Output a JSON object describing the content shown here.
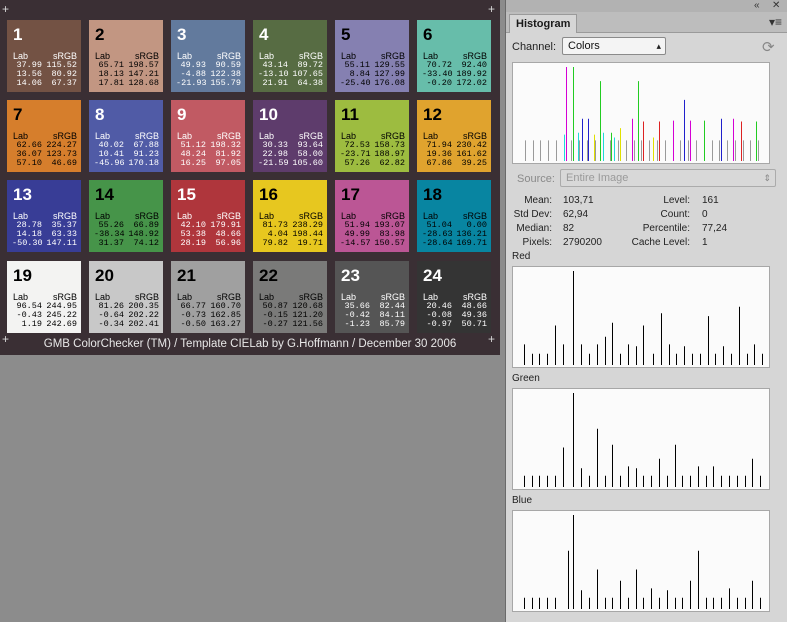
{
  "chart_title_caption": "GMB ColorChecker (TM) / Template CIELab by G.Hoffmann / December 30 2006",
  "patches": [
    {
      "num": "1",
      "lab": "Lab",
      "srgb": "sRGB",
      "l": "37.99\n13.56\n14.06",
      "r": "115.52\n80.92\n67.37",
      "bg": "#735244",
      "fg": "#ffffff"
    },
    {
      "num": "2",
      "lab": "Lab",
      "srgb": "sRGB",
      "l": "65.71\n18.13\n17.81",
      "r": "198.57\n147.21\n128.68",
      "bg": "#c29682",
      "fg": "#000000"
    },
    {
      "num": "3",
      "lab": "Lab",
      "srgb": "sRGB",
      "l": "49.93\n-4.88\n-21.93",
      "r": "90.59\n122.38\n155.79",
      "bg": "#627a9d",
      "fg": "#ffffff"
    },
    {
      "num": "4",
      "lab": "Lab",
      "srgb": "sRGB",
      "l": "43.14\n-13.10\n21.91",
      "r": "89.72\n107.65\n64.38",
      "bg": "#576c43",
      "fg": "#ffffff"
    },
    {
      "num": "5",
      "lab": "Lab",
      "srgb": "sRGB",
      "l": "55.11\n8.84\n-25.40",
      "r": "129.55\n127.99\n176.08",
      "bg": "#8580b1",
      "fg": "#000000"
    },
    {
      "num": "6",
      "lab": "Lab",
      "srgb": "sRGB",
      "l": "70.72\n-33.40\n-0.20",
      "r": "92.40\n189.92\n172.02",
      "bg": "#67bdaa",
      "fg": "#000000"
    },
    {
      "num": "7",
      "lab": "Lab",
      "srgb": "sRGB",
      "l": "62.66\n36.07\n57.10",
      "r": "224.27\n123.73\n46.69",
      "bg": "#d67e2c",
      "fg": "#000000"
    },
    {
      "num": "8",
      "lab": "Lab",
      "srgb": "sRGB",
      "l": "40.02\n10.41\n-45.96",
      "r": "67.88\n91.23\n170.18",
      "bg": "#505ba6",
      "fg": "#ffffff"
    },
    {
      "num": "9",
      "lab": "Lab",
      "srgb": "sRGB",
      "l": "51.12\n48.24\n16.25",
      "r": "198.32\n81.92\n97.05",
      "bg": "#c15a63",
      "fg": "#ffffff"
    },
    {
      "num": "10",
      "lab": "Lab",
      "srgb": "sRGB",
      "l": "30.33\n22.98\n-21.59",
      "r": "93.64\n58.00\n105.60",
      "bg": "#5e3c6c",
      "fg": "#ffffff"
    },
    {
      "num": "11",
      "lab": "Lab",
      "srgb": "sRGB",
      "l": "72.53\n-23.71\n57.26",
      "r": "158.73\n188.97\n62.82",
      "bg": "#9dbc40",
      "fg": "#000000"
    },
    {
      "num": "12",
      "lab": "Lab",
      "srgb": "sRGB",
      "l": "71.94\n19.36\n67.86",
      "r": "230.42\n161.62\n39.25",
      "bg": "#e0a32e",
      "fg": "#000000"
    },
    {
      "num": "13",
      "lab": "Lab",
      "srgb": "sRGB",
      "l": "28.78\n14.18\n-50.30",
      "r": "35.37\n63.33\n147.11",
      "bg": "#383d96",
      "fg": "#ffffff"
    },
    {
      "num": "14",
      "lab": "Lab",
      "srgb": "sRGB",
      "l": "55.26\n-38.34\n31.37",
      "r": "66.89\n148.92\n74.12",
      "bg": "#469449",
      "fg": "#000000"
    },
    {
      "num": "15",
      "lab": "Lab",
      "srgb": "sRGB",
      "l": "42.10\n53.38\n28.19",
      "r": "179.91\n48.66\n56.96",
      "bg": "#af363c",
      "fg": "#ffffff"
    },
    {
      "num": "16",
      "lab": "Lab",
      "srgb": "sRGB",
      "l": "81.73\n4.04\n79.82",
      "r": "238.29\n198.44\n19.71",
      "bg": "#e7c71f",
      "fg": "#000000"
    },
    {
      "num": "17",
      "lab": "Lab",
      "srgb": "sRGB",
      "l": "51.94\n49.99\n-14.57",
      "r": "193.07\n83.98\n150.57",
      "bg": "#bb5695",
      "fg": "#000000"
    },
    {
      "num": "18",
      "lab": "Lab",
      "srgb": "sRGB",
      "l": "51.04\n-28.63\n-28.64",
      "r": "0.00\n136.21\n169.71",
      "bg": "#0885a1",
      "fg": "#000000"
    },
    {
      "num": "19",
      "lab": "Lab",
      "srgb": "sRGB",
      "l": "96.54\n-0.43\n1.19",
      "r": "244.95\n245.22\n242.69",
      "bg": "#f3f3f2",
      "fg": "#000000"
    },
    {
      "num": "20",
      "lab": "Lab",
      "srgb": "sRGB",
      "l": "81.26\n-0.64\n-0.34",
      "r": "200.35\n202.22\n202.41",
      "bg": "#c8c8c8",
      "fg": "#000000"
    },
    {
      "num": "21",
      "lab": "Lab",
      "srgb": "sRGB",
      "l": "66.77\n-0.73\n-0.50",
      "r": "160.70\n162.85\n163.27",
      "bg": "#a0a0a0",
      "fg": "#000000"
    },
    {
      "num": "22",
      "lab": "Lab",
      "srgb": "sRGB",
      "l": "50.87\n-0.15\n-0.27",
      "r": "120.68\n121.20\n121.56",
      "bg": "#7a7a79",
      "fg": "#000000"
    },
    {
      "num": "23",
      "lab": "Lab",
      "srgb": "sRGB",
      "l": "35.66\n-0.42\n-1.23",
      "r": "82.44\n84.11\n85.79",
      "bg": "#555555",
      "fg": "#ffffff"
    },
    {
      "num": "24",
      "lab": "Lab",
      "srgb": "sRGB",
      "l": "20.46\n-0.08\n-0.97",
      "r": "48.66\n49.36\n50.71",
      "bg": "#343434",
      "fg": "#ffffff"
    }
  ],
  "panel": {
    "tab_label": "Histogram",
    "channel_label": "Channel:",
    "channel_value": "Colors",
    "source_label": "Source:",
    "source_value": "Entire Image",
    "stats": {
      "mean_label": "Mean:",
      "mean": "103,71",
      "std_label": "Std Dev:",
      "std": "62,94",
      "median_label": "Median:",
      "median": "82",
      "pixels_label": "Pixels:",
      "pixels": "2790200",
      "level_label": "Level:",
      "level": "161",
      "count_label": "Count:",
      "count": "0",
      "percentile_label": "Percentile:",
      "percentile": "77,24",
      "cache_label": "Cache Level:",
      "cache": "1"
    },
    "red_label": "Red",
    "green_label": "Green",
    "blue_label": "Blue"
  },
  "icons": {
    "collapse": "double-chevron-icon",
    "close": "close-icon",
    "menu": "panel-menu-icon",
    "refresh": "refresh-icon"
  },
  "chart_data": [
    {
      "type": "bar",
      "title": "Colors",
      "xlim": [
        0,
        255
      ],
      "ylim": [
        0,
        1
      ],
      "series": [
        {
          "color": "#9a9a9a",
          "bars": [
            [
              8,
              0.22
            ],
            [
              16,
              0.22
            ],
            [
              24,
              0.22
            ],
            [
              32,
              0.22
            ],
            [
              40,
              0.22
            ],
            [
              48,
              0.22
            ],
            [
              56,
              0.22
            ],
            [
              64,
              0.22
            ],
            [
              72,
              0.22
            ],
            [
              80,
              0.22
            ],
            [
              88,
              0.22
            ],
            [
              96,
              0.22
            ],
            [
              104,
              0.22
            ],
            [
              112,
              0.22
            ],
            [
              120,
              0.22
            ],
            [
              128,
              0.22
            ],
            [
              136,
              0.22
            ],
            [
              144,
              0.22
            ],
            [
              152,
              0.22
            ],
            [
              160,
              0.22
            ],
            [
              168,
              0.22
            ],
            [
              176,
              0.22
            ],
            [
              184,
              0.22
            ],
            [
              192,
              0.22
            ],
            [
              200,
              0.22
            ],
            [
              208,
              0.22
            ],
            [
              216,
              0.22
            ],
            [
              224,
              0.22
            ],
            [
              232,
              0.22
            ],
            [
              240,
              0.22
            ],
            [
              248,
              0.22
            ]
          ]
        },
        {
          "color": "#d400d4",
          "bars": [
            [
              50,
              1.0
            ],
            [
              118,
              0.45
            ],
            [
              160,
              0.43
            ],
            [
              178,
              0.43
            ],
            [
              222,
              0.45
            ]
          ]
        },
        {
          "color": "#22cc22",
          "bars": [
            [
              58,
              1.0
            ],
            [
              85,
              0.85
            ],
            [
              97,
              0.3
            ],
            [
              124,
              0.85
            ],
            [
              192,
              0.43
            ],
            [
              246,
              0.42
            ]
          ]
        },
        {
          "color": "#2020cc",
          "bars": [
            [
              67,
              0.45
            ],
            [
              73,
              0.45
            ],
            [
              172,
              0.65
            ],
            [
              210,
              0.45
            ]
          ]
        },
        {
          "color": "#22d8d8",
          "bars": [
            [
              48,
              0.28
            ],
            [
              63,
              0.3
            ],
            [
              88,
              0.3
            ],
            [
              100,
              0.25
            ]
          ]
        },
        {
          "color": "#e0e000",
          "bars": [
            [
              79,
              0.28
            ],
            [
              106,
              0.35
            ],
            [
              140,
              0.25
            ]
          ]
        },
        {
          "color": "#dd2222",
          "bars": [
            [
              130,
              0.42
            ],
            [
              146,
              0.42
            ],
            [
              230,
              0.42
            ]
          ]
        }
      ]
    },
    {
      "type": "bar",
      "title": "Red",
      "xlim": [
        0,
        255
      ],
      "ylim": [
        0,
        1
      ],
      "series": [
        {
          "name": "Red",
          "color": "#000000",
          "bars": [
            [
              7,
              0.22
            ],
            [
              15,
              0.12
            ],
            [
              23,
              0.12
            ],
            [
              31,
              0.12
            ],
            [
              39,
              0.42
            ],
            [
              47,
              0.22
            ],
            [
              58,
              1.0
            ],
            [
              66,
              0.22
            ],
            [
              74,
              0.12
            ],
            [
              82,
              0.22
            ],
            [
              90,
              0.3
            ],
            [
              98,
              0.45
            ],
            [
              106,
              0.12
            ],
            [
              114,
              0.22
            ],
            [
              122,
              0.2
            ],
            [
              130,
              0.42
            ],
            [
              140,
              0.12
            ],
            [
              148,
              0.55
            ],
            [
              156,
              0.22
            ],
            [
              164,
              0.12
            ],
            [
              172,
              0.2
            ],
            [
              180,
              0.12
            ],
            [
              188,
              0.12
            ],
            [
              196,
              0.52
            ],
            [
              204,
              0.12
            ],
            [
              212,
              0.2
            ],
            [
              220,
              0.12
            ],
            [
              228,
              0.62
            ],
            [
              236,
              0.12
            ],
            [
              244,
              0.22
            ],
            [
              252,
              0.12
            ]
          ]
        }
      ]
    },
    {
      "type": "bar",
      "title": "Green",
      "xlim": [
        0,
        255
      ],
      "ylim": [
        0,
        1
      ],
      "series": [
        {
          "name": "Green",
          "color": "#000000",
          "bars": [
            [
              7,
              0.12
            ],
            [
              15,
              0.12
            ],
            [
              23,
              0.12
            ],
            [
              31,
              0.12
            ],
            [
              39,
              0.12
            ],
            [
              47,
              0.42
            ],
            [
              58,
              1.0
            ],
            [
              66,
              0.2
            ],
            [
              74,
              0.12
            ],
            [
              82,
              0.62
            ],
            [
              90,
              0.12
            ],
            [
              98,
              0.45
            ],
            [
              106,
              0.12
            ],
            [
              114,
              0.22
            ],
            [
              122,
              0.2
            ],
            [
              130,
              0.12
            ],
            [
              138,
              0.12
            ],
            [
              146,
              0.3
            ],
            [
              154,
              0.12
            ],
            [
              162,
              0.45
            ],
            [
              170,
              0.12
            ],
            [
              178,
              0.12
            ],
            [
              186,
              0.22
            ],
            [
              194,
              0.12
            ],
            [
              202,
              0.22
            ],
            [
              210,
              0.12
            ],
            [
              218,
              0.12
            ],
            [
              226,
              0.12
            ],
            [
              234,
              0.12
            ],
            [
              242,
              0.3
            ],
            [
              250,
              0.12
            ]
          ]
        }
      ]
    },
    {
      "type": "bar",
      "title": "Blue",
      "xlim": [
        0,
        255
      ],
      "ylim": [
        0,
        1
      ],
      "series": [
        {
          "name": "Blue",
          "color": "#000000",
          "bars": [
            [
              7,
              0.12
            ],
            [
              15,
              0.12
            ],
            [
              23,
              0.12
            ],
            [
              31,
              0.12
            ],
            [
              39,
              0.12
            ],
            [
              52,
              0.62
            ],
            [
              58,
              1.0
            ],
            [
              66,
              0.2
            ],
            [
              74,
              0.12
            ],
            [
              82,
              0.42
            ],
            [
              90,
              0.12
            ],
            [
              98,
              0.12
            ],
            [
              106,
              0.3
            ],
            [
              114,
              0.12
            ],
            [
              122,
              0.42
            ],
            [
              130,
              0.12
            ],
            [
              138,
              0.22
            ],
            [
              146,
              0.12
            ],
            [
              154,
              0.2
            ],
            [
              162,
              0.12
            ],
            [
              170,
              0.12
            ],
            [
              178,
              0.3
            ],
            [
              186,
              0.62
            ],
            [
              194,
              0.12
            ],
            [
              202,
              0.12
            ],
            [
              210,
              0.12
            ],
            [
              218,
              0.22
            ],
            [
              226,
              0.12
            ],
            [
              234,
              0.12
            ],
            [
              242,
              0.3
            ],
            [
              250,
              0.12
            ]
          ]
        }
      ]
    }
  ]
}
